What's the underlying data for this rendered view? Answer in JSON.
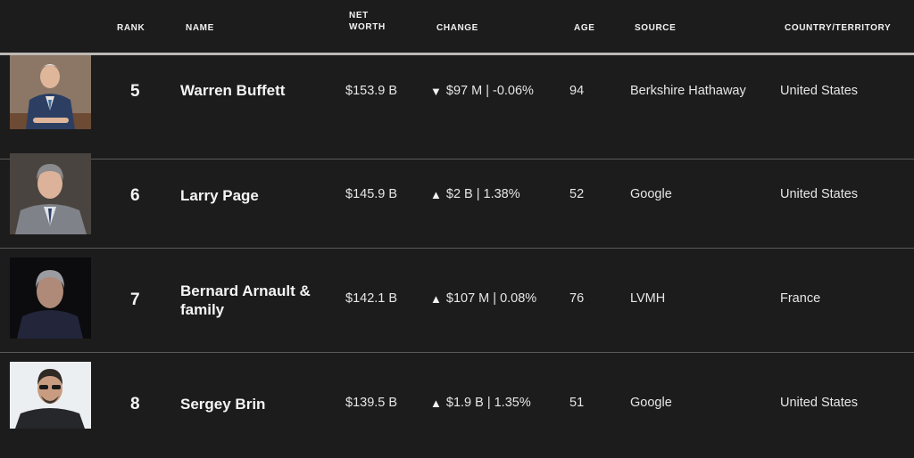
{
  "headers": {
    "rank": "RANK",
    "name": "NAME",
    "networth": "NET WORTH",
    "change": "CHANGE",
    "age": "AGE",
    "source": "SOURCE",
    "country": "COUNTRY/TERRITORY"
  },
  "rows": [
    {
      "rank": "5",
      "name": "Warren Buffett",
      "networth": "$153.9 B",
      "change_dir": "down",
      "change_arrow": "▼",
      "change": "$97 M | -0.06%",
      "age": "94",
      "source": "Berkshire Hathaway",
      "country": "United States"
    },
    {
      "rank": "6",
      "name": "Larry Page",
      "networth": "$145.9 B",
      "change_dir": "up",
      "change_arrow": "▲",
      "change": "$2 B | 1.38%",
      "age": "52",
      "source": "Google",
      "country": "United States"
    },
    {
      "rank": "7",
      "name": "Bernard Arnault & family",
      "networth": "$142.1 B",
      "change_dir": "up",
      "change_arrow": "▲",
      "change": "$107 M | 0.08%",
      "age": "76",
      "source": "LVMH",
      "country": "France"
    },
    {
      "rank": "8",
      "name": "Sergey Brin",
      "networth": "$139.5 B",
      "change_dir": "up",
      "change_arrow": "▲",
      "change": "$1.9 B | 1.35%",
      "age": "51",
      "source": "Google",
      "country": "United States"
    }
  ]
}
